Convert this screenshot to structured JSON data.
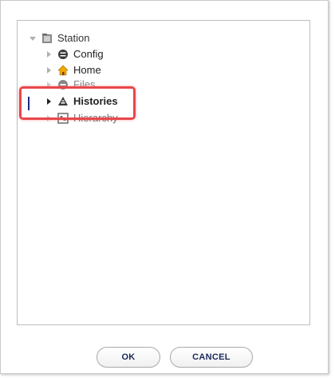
{
  "tree": {
    "root": {
      "label": "Station",
      "icon": "station-icon",
      "expanded": true
    },
    "children": [
      {
        "label": "Config",
        "icon": "config-icon"
      },
      {
        "label": "Home",
        "icon": "home-icon"
      },
      {
        "label": "Files",
        "icon": "files-icon"
      },
      {
        "label": "Histories",
        "icon": "histories-icon",
        "selected": true
      },
      {
        "label": "Hierarchy",
        "icon": "hierarchy-icon"
      }
    ]
  },
  "buttons": {
    "ok_label": "OK",
    "cancel_label": "CANCEL"
  },
  "colors": {
    "highlight": "#e8474a",
    "button_text": "#1b2a5c",
    "home_icon": "#f2a900",
    "focus_bar": "#1a2a8c"
  }
}
